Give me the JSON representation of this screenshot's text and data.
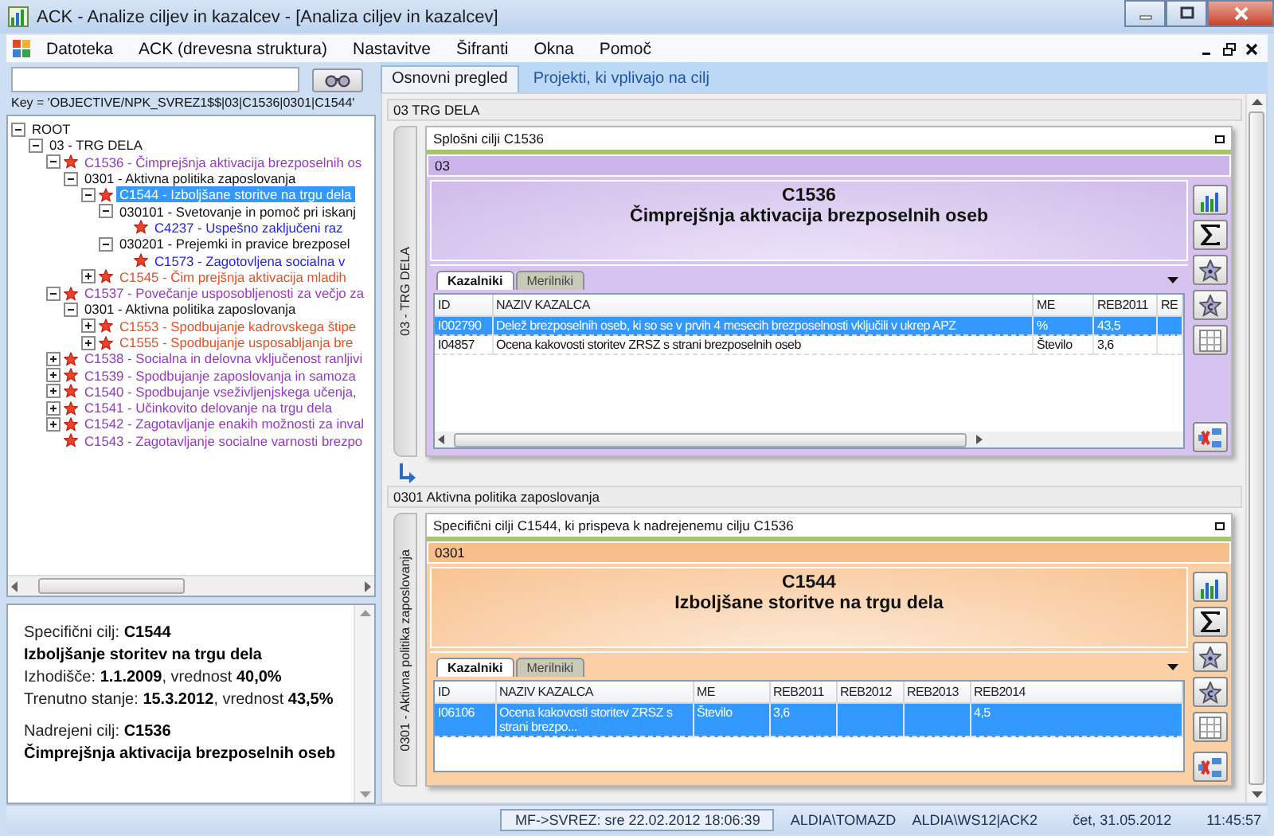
{
  "window": {
    "title": "ACK - Analize ciljev in kazalcev - [Analiza ciljev in kazalcev]"
  },
  "menu": [
    "Datoteka",
    "ACK (drevesna struktura)",
    "Nastavitve",
    "Šifranti",
    "Okna",
    "Pomoč"
  ],
  "key_text": "Key = 'OBJECTIVE/NPK_SVREZ1$$|03|C1536|0301|C1544'",
  "tree": [
    {
      "label": "ROOT",
      "kind": "group",
      "expanded": true,
      "selected": false,
      "children": [
        {
          "label": "03 - TRG DELA",
          "kind": "group",
          "expanded": true,
          "selected": false,
          "children": [
            {
              "label": "C1536 - Čimprejšnja aktivacija brezposelnih os",
              "kind": "general",
              "expanded": true,
              "selected": false,
              "children": [
                {
                  "label": "0301 - Aktivna politika zaposlovanja",
                  "kind": "group",
                  "expanded": true,
                  "selected": false,
                  "children": [
                    {
                      "label": "C1544 - Izboljšane storitve na trgu dela",
                      "kind": "specific",
                      "expanded": true,
                      "selected": true,
                      "children": [
                        {
                          "label": "030101 - Svetovanje in pomoč pri iskanj",
                          "kind": "group",
                          "expanded": true,
                          "selected": false,
                          "children": [
                            {
                              "label": "C4237 - Uspešno zaključeni raz",
                              "kind": "operational",
                              "selected": false
                            }
                          ]
                        },
                        {
                          "label": "030201 - Prejemki in pravice brezposel",
                          "kind": "group",
                          "expanded": true,
                          "selected": false,
                          "children": [
                            {
                              "label": "C1573 - Zagotovljena socialna v",
                              "kind": "operational",
                              "selected": false
                            }
                          ]
                        }
                      ]
                    },
                    {
                      "label": "C1545 - Čim prejšnja aktivacija mladih",
                      "kind": "specific",
                      "expanded": false,
                      "selected": false
                    }
                  ]
                }
              ]
            },
            {
              "label": "C1537 - Povečanje usposobljenosti za večjo za",
              "kind": "general",
              "expanded": true,
              "selected": false,
              "children": [
                {
                  "label": "0301 - Aktivna politika zaposlovanja",
                  "kind": "group",
                  "expanded": true,
                  "selected": false,
                  "children": [
                    {
                      "label": "C1553 - Spodbujanje kadrovskega štipe",
                      "kind": "specific",
                      "expanded": false,
                      "selected": false
                    },
                    {
                      "label": "C1555 - Spodbujanje usposabljanja bre",
                      "kind": "specific",
                      "expanded": false,
                      "selected": false
                    }
                  ]
                }
              ]
            },
            {
              "label": "C1538 - Socialna in delovna vključenost ranljivi",
              "kind": "general",
              "expanded": false,
              "selected": false
            },
            {
              "label": "C1539 - Spodbujanje  zaposlovanja in samoza",
              "kind": "general",
              "expanded": false,
              "selected": false
            },
            {
              "label": "C1540 - Spodbujanje vseživljenjskega učenja,",
              "kind": "general",
              "expanded": false,
              "selected": false
            },
            {
              "label": "C1541 - Učinkovito delovanje na trgu dela",
              "kind": "general",
              "expanded": false,
              "selected": false
            },
            {
              "label": "C1542 - Zagotavljanje enakih možnosti za inval",
              "kind": "general",
              "expanded": false,
              "selected": false
            },
            {
              "label": "C1543 - Zagotavljanje socialne varnosti brezpo",
              "kind": "general",
              "selected": false
            }
          ]
        }
      ]
    }
  ],
  "info": [
    {
      "lines": [
        {
          "kind": "text",
          "text": "Specifični cilj: **C1544**"
        },
        {
          "kind": "title",
          "text": "Izboljšanje storitev na trgu dela"
        },
        {
          "kind": "text",
          "text": "Izhodišče: **1.1.2009**,  vrednost **40,0%**"
        },
        {
          "kind": "text",
          "text": "Trenutno stanje: **15.3.2012**,  vrednost **43,5%**"
        }
      ]
    },
    {
      "lines": [
        {
          "kind": "text",
          "text": "Nadrejeni cilj: **C1536**"
        },
        {
          "kind": "title",
          "text": "Čimprejšnja aktivacija brezposelnih oseb"
        }
      ]
    }
  ],
  "tabs": [
    {
      "label": "Osnovni pregled",
      "selected": true
    },
    {
      "label": "Projekti, ki vplivajo na cilj",
      "selected": false
    }
  ],
  "sections": [
    {
      "header": "03 TRG DELA",
      "side_label": "03 - TRG DELA",
      "card": {
        "kind": "general",
        "title": "Splošni cilji C1536",
        "band": "03",
        "code": "C1536",
        "name": "Čimprejšnja aktivacija brezposelnih oseb",
        "tabs": [
          {
            "label": "Kazalniki",
            "selected": true
          },
          {
            "label": "Merilniki",
            "selected": false
          }
        ],
        "columns": [
          "ID",
          "NAZIV KAZALCA",
          "ME",
          "REB2011",
          "RE"
        ],
        "rows": [
          {
            "selected": true,
            "cells": [
              "I002790",
              "Delež brezposelnih oseb, ki so se v prvih 4 mesecih brezposelnosti vključili v ukrep APZ",
              "%",
              "43,5",
              ""
            ]
          },
          {
            "selected": false,
            "cells": [
              "I04857",
              "Ocena kakovosti storitev ZRSZ s strani brezposelnih oseb",
              "Število",
              "3,6",
              ""
            ]
          }
        ]
      }
    },
    {
      "header": "0301 Aktivna politika zaposlovanja",
      "side_label": "0301 - Aktivna politika zaposlovanja",
      "card": {
        "kind": "specific",
        "title": "Specifični cilji C1544, ki prispeva k nadrejenemu cilju C1536",
        "band": "0301",
        "code": "C1544",
        "name": "Izboljšane storitve na trgu dela",
        "tabs": [
          {
            "label": "Kazalniki",
            "selected": true
          },
          {
            "label": "Merilniki",
            "selected": false
          }
        ],
        "columns": [
          "ID",
          "NAZIV KAZALCA",
          "ME",
          "REB2011",
          "REB2012",
          "REB2013",
          "REB2014"
        ],
        "rows": [
          {
            "selected": true,
            "cells": [
              "I06106",
              "Ocena kakovosti storitev ZRSZ s strani brezpo...",
              "Število",
              "3,6",
              "",
              "",
              "4,5"
            ]
          }
        ]
      }
    }
  ],
  "status_bar": {
    "sync": "MF->SVREZ: sre 22.02.2012 18:06:39",
    "user": "ALDIA\\TOMAZD",
    "station": "ALDIA\\WS12|ACK2",
    "date": "čet, 31.05.2012",
    "time": "11:45:57"
  }
}
